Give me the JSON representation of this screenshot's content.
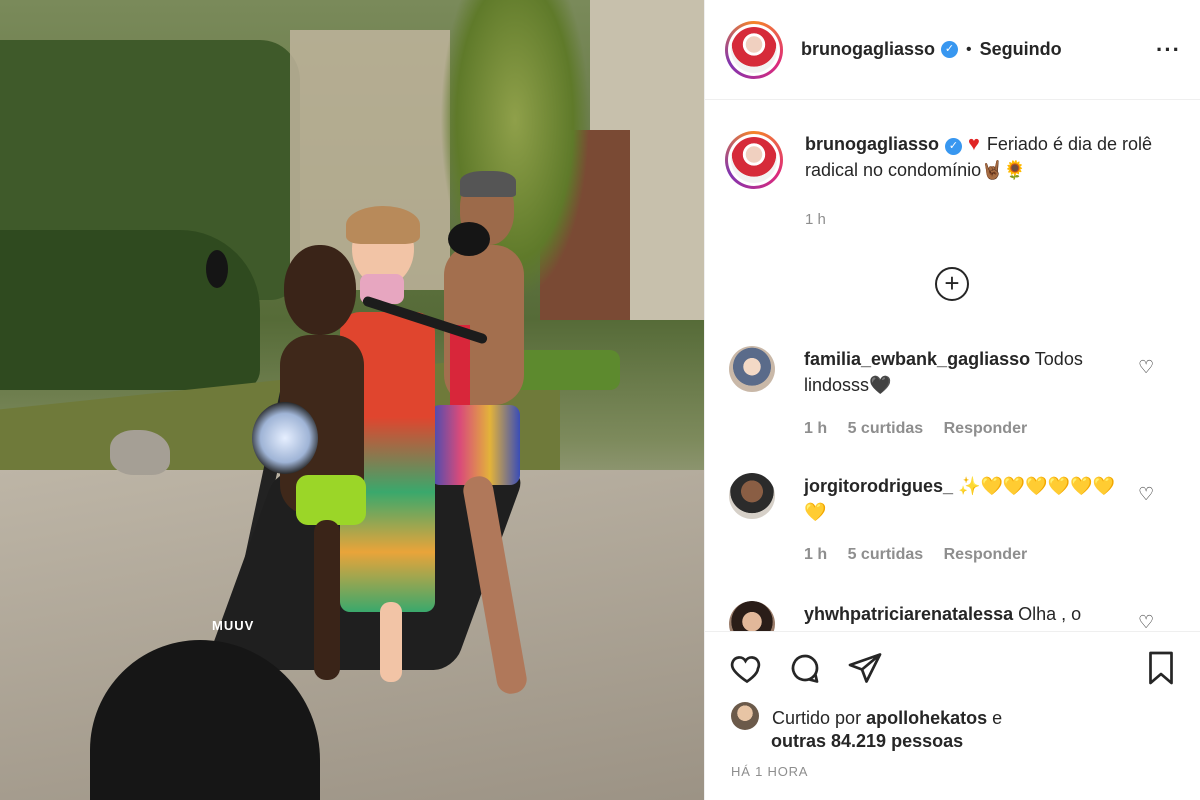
{
  "post": {
    "username": "brunogagliasso",
    "verified": true,
    "follow_status": "Seguindo",
    "more_icon": "more-horizontal-icon"
  },
  "photo": {
    "scooter_brand": "MUUV"
  },
  "caption": {
    "username": "brunogagliasso",
    "text_before": "Feriado é dia de rolê radical no condomínio",
    "emoji_suffix": "🤘🏾🌻",
    "time": "1 h"
  },
  "load_more_icon": "plus-circle-icon",
  "comments": [
    {
      "username": "familia_ewbank_gagliasso",
      "text": "Todos lindosss🖤",
      "time": "1 h",
      "likes": "5 curtidas",
      "reply": "Responder"
    },
    {
      "username": "jorgitorodrigues_",
      "text": "✨💛💛💛💛💛💛💛",
      "time": "1 h",
      "likes": "5 curtidas",
      "reply": "Responder"
    },
    {
      "username": "yhwhpatriciarenatalessa",
      "text": "Olha , o"
    }
  ],
  "actions": {
    "like_icon": "heart-icon",
    "comment_icon": "comment-icon",
    "share_icon": "send-icon",
    "save_icon": "bookmark-icon"
  },
  "likes": {
    "prefix": "Curtido por",
    "user": "apollohekatos",
    "connector": "e",
    "others": "outras 84.219 pessoas"
  },
  "timestamp": "HÁ 1 HORA",
  "colors": {
    "verified": "#3897f0",
    "muted": "#8e8e8e",
    "text": "#262626",
    "heart_red": "#e02424"
  }
}
